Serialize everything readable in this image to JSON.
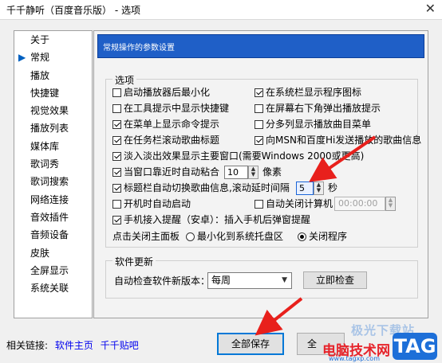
{
  "window": {
    "title": "千千静听（百度音乐版） - 选项",
    "close_glyph": "✕"
  },
  "sidebar": {
    "active_marker": "▶",
    "items": [
      "关于",
      "常规",
      "播放",
      "快捷键",
      "视觉效果",
      "播放列表",
      "媒体库",
      "歌词秀",
      "歌词搜索",
      "网络连接",
      "音效插件",
      "音频设备",
      "皮肤",
      "全屏显示",
      "系统关联"
    ]
  },
  "panel": {
    "header": "常规操作的参数设置",
    "options": {
      "legend": "选项",
      "items": {
        "start_minimized": {
          "label": "启动播放器后最小化",
          "checked": false
        },
        "tray_icon": {
          "label": "在系统栏显示程序图标",
          "checked": true
        },
        "tooltip_hotkeys": {
          "label": "在工具提示中显示快捷键",
          "checked": false
        },
        "bottom_right_popup": {
          "label": "在屏幕右下角弹出播放提示",
          "checked": false
        },
        "menu_cmd_tips": {
          "label": "在菜单上显示命令提示",
          "checked": true
        },
        "split_song_menu": {
          "label": "分多列显示播放曲目菜单",
          "checked": false
        },
        "taskbar_scroll": {
          "label": "在任务栏滚动歌曲标题",
          "checked": true
        },
        "send_to_msn": {
          "label": "向MSN和百度Hi发送播放的歌曲信息",
          "checked": true
        },
        "fade_window": {
          "label": "淡入淡出效果显示主要窗口(需要Windows 2000或更高)",
          "checked": true
        },
        "snap": {
          "label": "当窗口靠近时自动粘合",
          "checked": true,
          "value": "10",
          "unit": "像素"
        },
        "title_scroll": {
          "label": "标题栏自动切换歌曲信息,滚动延时间隔",
          "checked": true,
          "value": "5",
          "unit": "秒"
        },
        "autostart": {
          "label": "开机时自动启动",
          "checked": false
        },
        "auto_shutdown": {
          "label": "自动关闭计算机",
          "checked": false,
          "time": "00:00:00"
        },
        "phone_popup": {
          "label": "手机接入提醒（安卓）：插入手机后弹窗提醒",
          "checked": true
        }
      },
      "close_behavior": {
        "label": "点击关闭主面板",
        "minimize": {
          "label": "最小化到系统托盘区",
          "selected": false
        },
        "exit": {
          "label": "关闭程序",
          "selected": true
        }
      }
    },
    "update": {
      "legend": "软件更新",
      "label": "自动检查软件新版本：",
      "frequency": "每周",
      "check_button": "立即检查"
    }
  },
  "footer": {
    "related_label": "相关链接:",
    "link_home": "软件主页",
    "link_forum": "千千贴吧",
    "save_all_button": "全部保存",
    "second_button_partial": "全"
  },
  "watermark": {
    "line1": "极光下载站",
    "line2": "电脑技术网",
    "tag": "TAG",
    "url": "www.tagxp.com"
  },
  "colors": {
    "accent": "#1f5fc7",
    "arrow": "#e8201c",
    "watermark_blue": "#1d6fd8",
    "watermark_red": "#e6232a"
  }
}
